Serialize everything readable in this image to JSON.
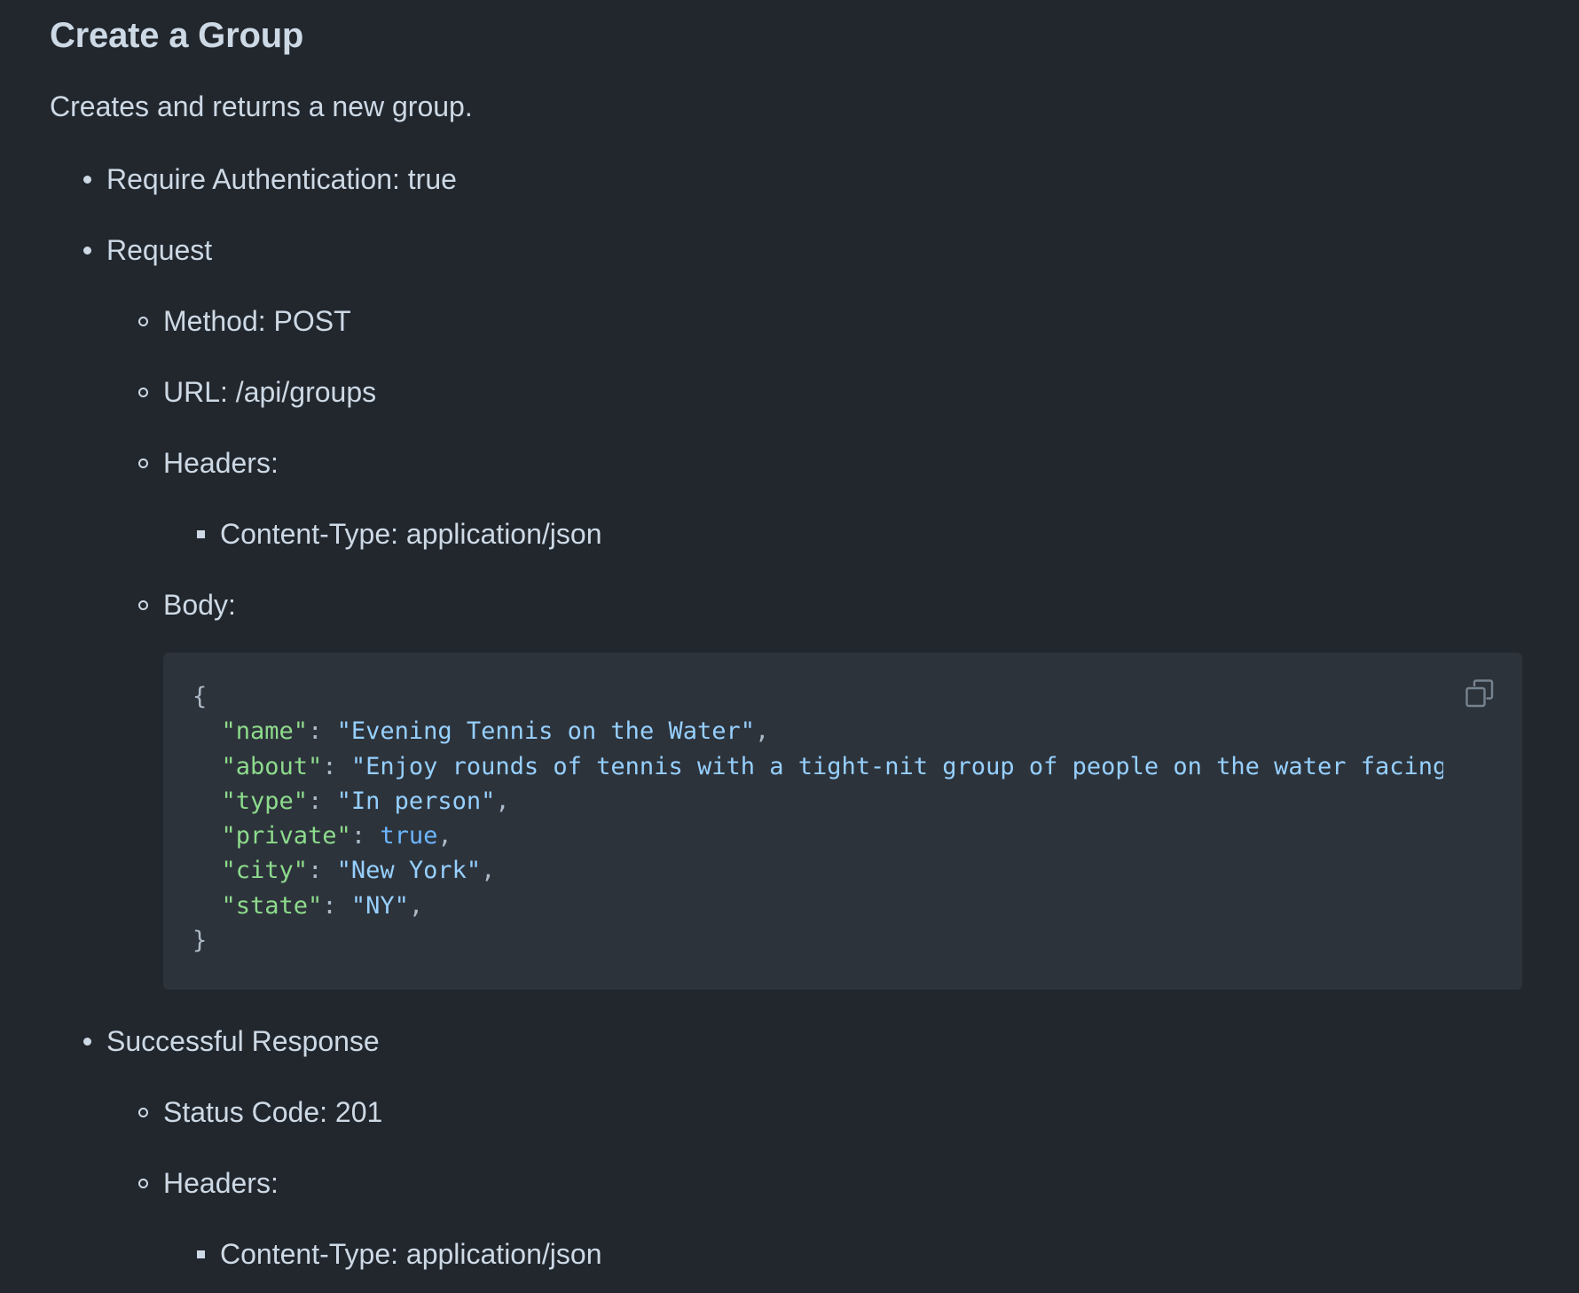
{
  "heading": "Create a Group",
  "description": "Creates and returns a new group.",
  "request_section": {
    "auth": "Require Authentication: true",
    "request_label": "Request",
    "method": "Method: POST",
    "url": "URL: /api/groups",
    "headers_label": "Headers:",
    "content_type": "Content-Type: application/json",
    "body_label": "Body:"
  },
  "code_block": {
    "copy_icon": "copy-icon",
    "lines": [
      [
        {
          "t": "punc",
          "v": "{"
        }
      ],
      [
        {
          "t": "punc",
          "v": "  "
        },
        {
          "t": "key",
          "v": "\"name\""
        },
        {
          "t": "punc",
          "v": ": "
        },
        {
          "t": "str",
          "v": "\"Evening Tennis on the Water\""
        },
        {
          "t": "punc",
          "v": ","
        }
      ],
      [
        {
          "t": "punc",
          "v": "  "
        },
        {
          "t": "key",
          "v": "\"about\""
        },
        {
          "t": "punc",
          "v": ": "
        },
        {
          "t": "str",
          "v": "\"Enjoy rounds of tennis with a tight-nit group of people on the water facing"
        }
      ],
      [
        {
          "t": "punc",
          "v": "  "
        },
        {
          "t": "key",
          "v": "\"type\""
        },
        {
          "t": "punc",
          "v": ": "
        },
        {
          "t": "str",
          "v": "\"In person\""
        },
        {
          "t": "punc",
          "v": ","
        }
      ],
      [
        {
          "t": "punc",
          "v": "  "
        },
        {
          "t": "key",
          "v": "\"private\""
        },
        {
          "t": "punc",
          "v": ": "
        },
        {
          "t": "bool",
          "v": "true"
        },
        {
          "t": "punc",
          "v": ","
        }
      ],
      [
        {
          "t": "punc",
          "v": "  "
        },
        {
          "t": "key",
          "v": "\"city\""
        },
        {
          "t": "punc",
          "v": ": "
        },
        {
          "t": "str",
          "v": "\"New York\""
        },
        {
          "t": "punc",
          "v": ","
        }
      ],
      [
        {
          "t": "punc",
          "v": "  "
        },
        {
          "t": "key",
          "v": "\"state\""
        },
        {
          "t": "punc",
          "v": ": "
        },
        {
          "t": "str",
          "v": "\"NY\""
        },
        {
          "t": "punc",
          "v": ","
        }
      ],
      [
        {
          "t": "punc",
          "v": "}"
        }
      ]
    ]
  },
  "response_section": {
    "label": "Successful Response",
    "status": "Status Code: 201",
    "headers_label": "Headers:",
    "content_type": "Content-Type: application/json"
  },
  "colors": {
    "background": "#22272e",
    "code_background": "#2d333b",
    "text": "#cdd9e5",
    "json_key": "#8ddb8c",
    "json_string": "#96d0ff",
    "json_boolean": "#6cb6ff"
  }
}
